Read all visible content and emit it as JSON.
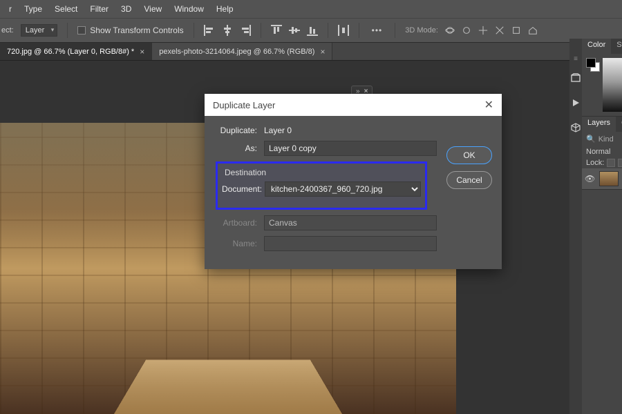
{
  "menu": {
    "items": [
      "r",
      "Type",
      "Select",
      "Filter",
      "3D",
      "View",
      "Window",
      "Help"
    ]
  },
  "options": {
    "ect_label": "ect:",
    "layer_dropdown": "Layer",
    "show_transform": "Show Transform Controls",
    "mode3d_label": "3D Mode:"
  },
  "tabs": [
    {
      "label": "720.jpg @ 66.7% (Layer 0, RGB/8#) *",
      "active": true
    },
    {
      "label": "pexels-photo-3214064.jpeg @ 66.7% (RGB/8)",
      "active": false
    }
  ],
  "dialog": {
    "title": "Duplicate Layer",
    "duplicate_label": "Duplicate:",
    "duplicate_value": "Layer 0",
    "as_label": "As:",
    "as_value": "Layer 0 copy",
    "destination_title": "Destination",
    "document_label": "Document:",
    "document_value": "kitchen-2400367_960_720.jpg",
    "artboard_label": "Artboard:",
    "artboard_value": "Canvas",
    "name_label": "Name:",
    "name_value": "",
    "ok": "OK",
    "cancel": "Cancel"
  },
  "side": {
    "color_tab": "Color",
    "swatches_tab": "Swa",
    "layers_tab": "Layers",
    "channels_tab": "Ch",
    "kind_placeholder": "Kind",
    "blend_mode": "Normal",
    "lock_label": "Lock:"
  }
}
